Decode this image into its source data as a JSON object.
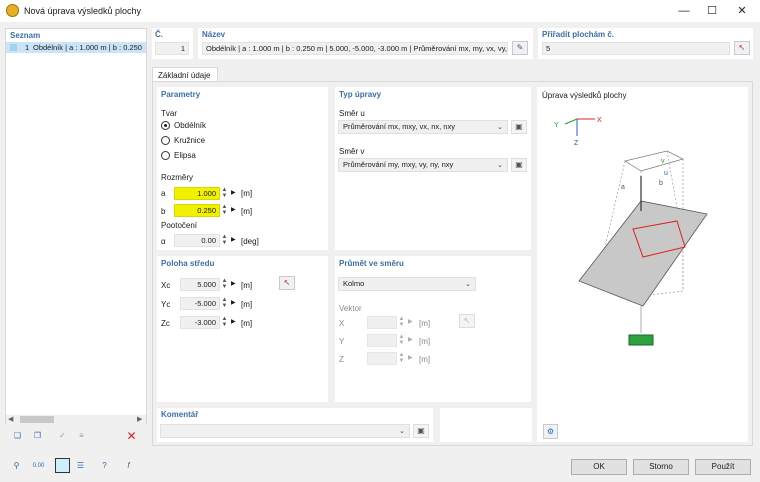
{
  "window": {
    "title": "Nová úprava výsledků plochy",
    "min_icon": "minimize-icon",
    "max_icon": "maximize-icon",
    "close_icon": "close-icon"
  },
  "list": {
    "header": "Seznam",
    "items": [
      {
        "num": "1",
        "text": "Obdélník | a : 1.000 m | b : 0.250"
      }
    ]
  },
  "number": {
    "label": "Č.",
    "value": "1"
  },
  "name": {
    "label": "Název",
    "value": "Obdélník | a : 1.000 m | b : 0.250 m | 5.000, -5.000, -3.000 m | Průměrování mx, my, vx, vy, nx"
  },
  "assign": {
    "label": "Přiřadit plochám č.",
    "value": "5"
  },
  "tab": {
    "label": "Základní údaje"
  },
  "params": {
    "header": "Parametry",
    "shape_label": "Tvar",
    "shapes": [
      "Obdélník",
      "Kružnice",
      "Elipsa"
    ],
    "selected": 0,
    "dims_label": "Rozměry",
    "a_label": "a",
    "a_value": "1.000",
    "a_unit": "[m]",
    "b_label": "b",
    "b_value": "0.250",
    "b_unit": "[m]",
    "rot_label": "Pootočení",
    "alpha_label": "α",
    "alpha_value": "0.00",
    "alpha_unit": "[deg]"
  },
  "type": {
    "header": "Typ úpravy",
    "u_label": "Směr u",
    "u_value": "Průměrování mx, mxy, vx, nx, nxy",
    "v_label": "Směr v",
    "v_value": "Průměrování my, mxy, vy, ny, nxy"
  },
  "center": {
    "header": "Poloha středu",
    "xc_label": "Xc",
    "xc_value": "5.000",
    "yc_label": "Yc",
    "yc_value": "-5.000",
    "zc_label": "Zc",
    "zc_value": "-3.000",
    "unit": "[m]"
  },
  "proj": {
    "header": "Průmět ve směru",
    "value": "Kolmo",
    "vector_label": "Vektor",
    "x_label": "X",
    "y_label": "Y",
    "z_label": "Z",
    "unit": "[m]"
  },
  "preview": {
    "title": "Úprava výsledků plochy",
    "x_axis": "X",
    "y_axis": "Y",
    "z_axis": "Z",
    "a_lbl": "a",
    "b_lbl": "b",
    "u_lbl": "u",
    "v_lbl": "v"
  },
  "comment": {
    "label": "Komentář"
  },
  "buttons": {
    "ok": "OK",
    "cancel": "Storno",
    "apply": "Použít"
  },
  "colors": {
    "accent": "#3b6ea8",
    "highlight": "#f0f000",
    "red": "#e02020"
  }
}
